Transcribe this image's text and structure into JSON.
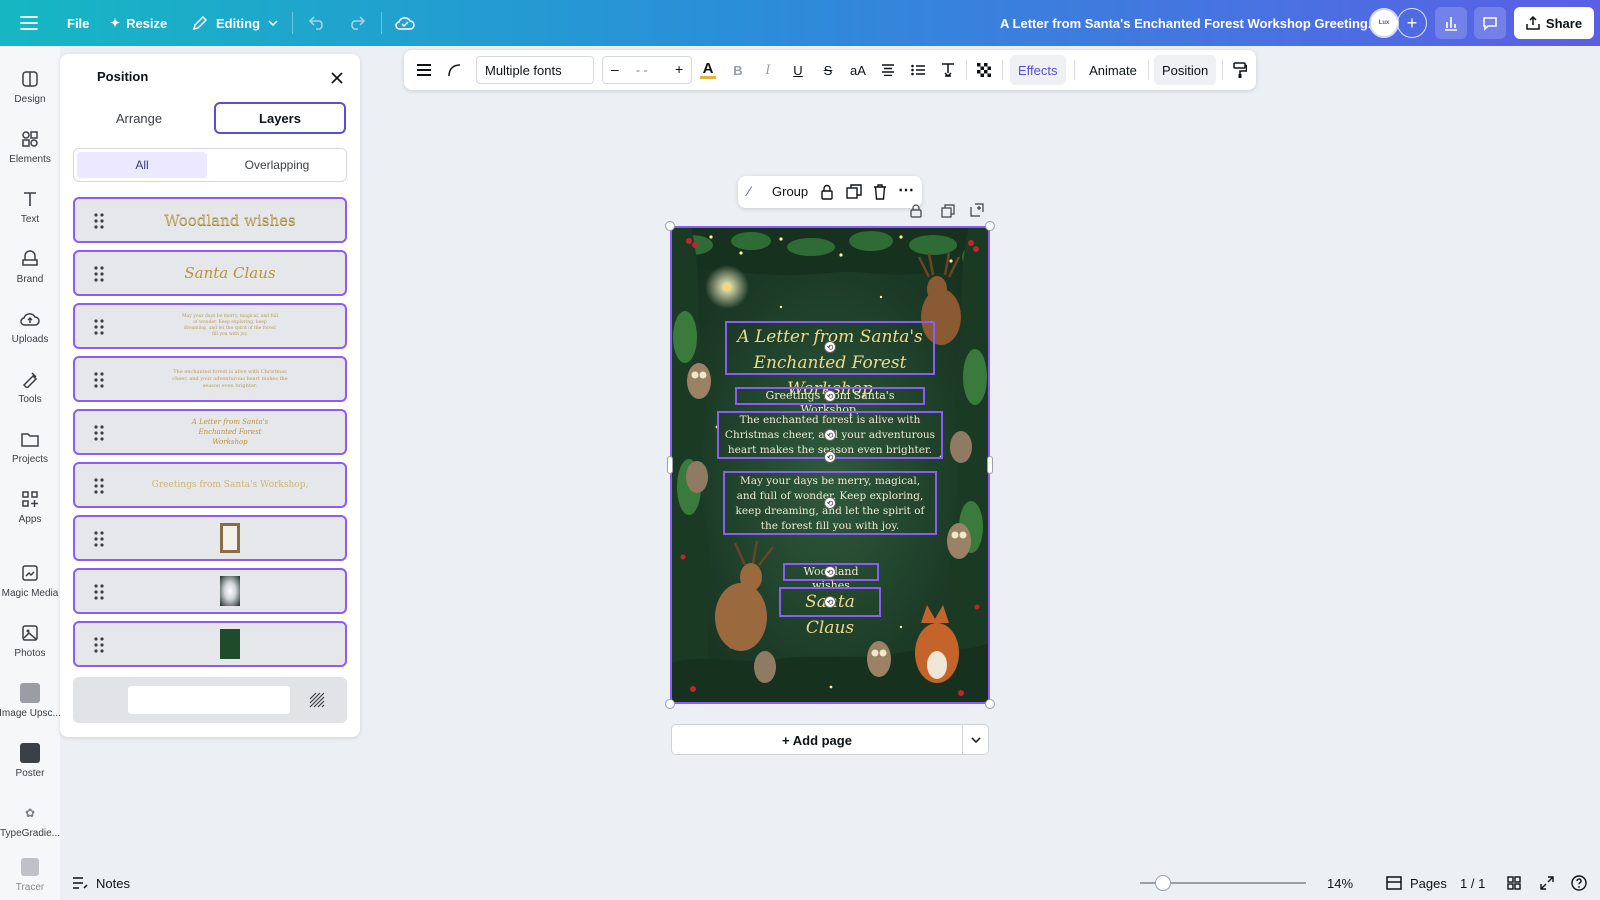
{
  "topbar": {
    "file_label": "File",
    "resize_label": "Resize",
    "editing_label": "Editing",
    "doc_title": "A Letter from Santa's Enchanted Forest Workshop Greeting...",
    "share_label": "Share"
  },
  "rail": {
    "items": [
      {
        "label": "Design",
        "icon": "design-icon"
      },
      {
        "label": "Elements",
        "icon": "elements-icon"
      },
      {
        "label": "Text",
        "icon": "text-icon"
      },
      {
        "label": "Brand",
        "icon": "brand-icon"
      },
      {
        "label": "Uploads",
        "icon": "uploads-icon"
      },
      {
        "label": "Tools",
        "icon": "tools-icon"
      },
      {
        "label": "Projects",
        "icon": "projects-icon"
      },
      {
        "label": "Apps",
        "icon": "apps-icon"
      },
      {
        "label": "Magic Media",
        "icon": "magic-media-icon"
      },
      {
        "label": "Photos",
        "icon": "photos-icon"
      },
      {
        "label": "Image Upsc...",
        "icon": "image-upscaler-icon"
      },
      {
        "label": "Poster",
        "icon": "poster-icon"
      },
      {
        "label": "TypeGradie...",
        "icon": "typegradient-icon"
      },
      {
        "label": "Tracer",
        "icon": "tracer-icon"
      }
    ]
  },
  "panel": {
    "title": "Position",
    "tabs": [
      "Arrange",
      "Layers"
    ],
    "active_tab": "Layers",
    "filters": [
      "All",
      "Overlapping"
    ],
    "active_filter": "All",
    "layers": [
      {
        "preview": "Woodland wishes"
      },
      {
        "preview": "Santa Claus"
      },
      {
        "preview": "May your days be merry, magical, and full of wonder. Keep exploring, keep dreaming, and let the spirit of the forest fill you with joy."
      },
      {
        "preview": "The enchanted forest is alive with Christmas cheer, and your adventurous heart makes the season even brighter."
      },
      {
        "preview": "A Letter from Santa's Enchanted Forest Workshop"
      },
      {
        "preview": "Greetings from Santa's Workshop,"
      },
      {
        "preview": ""
      },
      {
        "preview": ""
      },
      {
        "preview": ""
      }
    ]
  },
  "toolbar": {
    "font_name": "Multiple fonts",
    "size_value": "- -",
    "effects_label": "Effects",
    "animate_label": "Animate",
    "position_label": "Position"
  },
  "group_bar": {
    "label": "Group"
  },
  "design": {
    "title_line1": "A Letter from Santa's",
    "title_line2": "Enchanted Forest Workshop",
    "greeting": "Greetings from Santa's Workshop,",
    "para1": "The enchanted forest is alive with Christmas cheer, and your adventurous heart makes the season even brighter.",
    "para2": "May your days be merry, magical, and full of wonder. Keep exploring, keep dreaming, and let the spirit of the forest fill you with joy.",
    "closing": "Woodland wishes",
    "signature": "Santa Claus"
  },
  "add_page_label": "+ Add page",
  "bottom": {
    "notes_label": "Notes",
    "zoom_label": "14%",
    "zoom_value": 0.14,
    "pages_label": "Pages",
    "page_count": "1 / 1"
  },
  "colors": {
    "accent": "#8b5cf6",
    "topbar_start": "#16b7c3",
    "topbar_end": "#5b5fe6",
    "card_text_gold": "#efd98c"
  }
}
